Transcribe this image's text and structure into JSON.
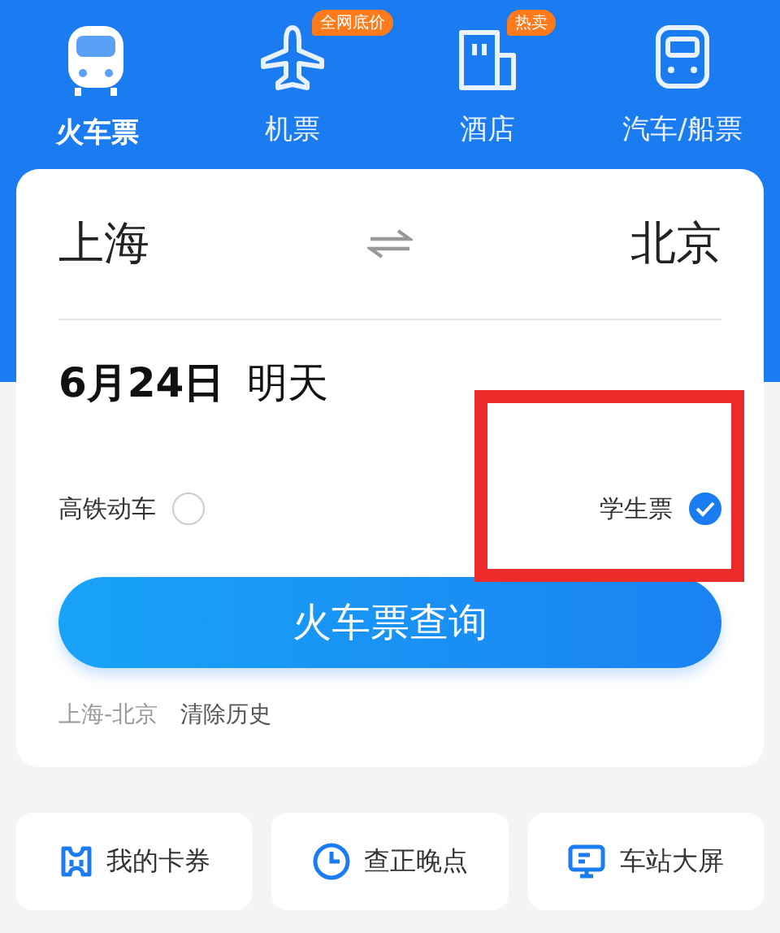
{
  "nav": [
    {
      "kind": "train",
      "label": "火车票",
      "selected": true
    },
    {
      "kind": "plane",
      "label": "机票",
      "badge": "全网底价",
      "selected": false
    },
    {
      "kind": "hotel",
      "label": "酒店",
      "badge": "热卖",
      "selected": false
    },
    {
      "kind": "bus",
      "label": "汽车/船票",
      "selected": false
    }
  ],
  "search": {
    "from": "上海",
    "to": "北京",
    "date": "6月24日",
    "day": "明天",
    "options": [
      {
        "label": "高铁动车",
        "checked": false
      },
      {
        "label": "学生票",
        "checked": true
      }
    ],
    "button": "火车票查询",
    "history": [
      {
        "kind": "route",
        "label": "上海-北京"
      },
      {
        "kind": "clear",
        "label": "清除历史"
      }
    ]
  },
  "shortcuts": [
    {
      "kind": "card",
      "label": "我的卡券"
    },
    {
      "kind": "clock",
      "label": "查正晚点"
    },
    {
      "kind": "screen",
      "label": "车站大屏"
    }
  ]
}
